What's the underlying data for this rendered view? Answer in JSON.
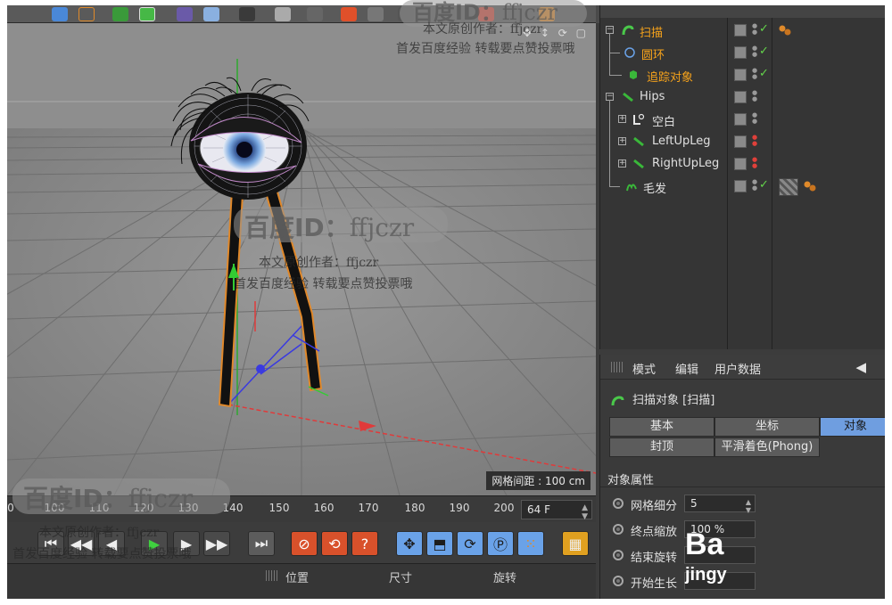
{
  "viewport": {
    "grid_spacing": "网格间距 : 100 cm",
    "nav_icons": [
      "move-view-icon",
      "zoom-view-icon",
      "rotate-view-icon",
      "maximize-view-icon"
    ]
  },
  "timeline": {
    "ticks": [
      "0",
      "100",
      "110",
      "120",
      "130",
      "140",
      "150",
      "160",
      "170",
      "180",
      "190",
      "200"
    ],
    "end_frame": "64 F"
  },
  "transport": {
    "buttons": [
      "go-to-start",
      "previous-key",
      "previous-frame",
      "play",
      "next-frame",
      "go-to-end",
      "record-active",
      "autokey",
      "keyframe-help",
      "key-position",
      "key-scale",
      "key-rotation",
      "key-param",
      "key-pla",
      "timeline-window"
    ]
  },
  "coordinates": {
    "position": "位置",
    "size": "尺寸",
    "rotation": "旋转"
  },
  "object_manager": {
    "objects": [
      {
        "label": "扫描",
        "color": "orange",
        "icon": "sweep-icon",
        "check": true,
        "tag": "tag-balls"
      },
      {
        "label": "圆环",
        "color": "orange",
        "icon": "circle-spline-icon",
        "check": true
      },
      {
        "label": "追踪对象",
        "color": "orange",
        "icon": "tracer-icon",
        "check": true
      },
      {
        "label": "Hips",
        "color": "white",
        "icon": "joint-icon",
        "check": false
      },
      {
        "label": "空白",
        "color": "white",
        "icon": "null-icon",
        "check": false
      },
      {
        "label": "LeftUpLeg",
        "color": "white",
        "icon": "joint-icon",
        "check": false
      },
      {
        "label": "RightUpLeg",
        "color": "white",
        "icon": "joint-icon",
        "check": false
      },
      {
        "label": "毛发",
        "color": "white",
        "icon": "hair-icon",
        "check": true,
        "tag": "hair-material-tag"
      }
    ]
  },
  "attribute_manager": {
    "menu": [
      "模式",
      "编辑",
      "用户数据"
    ],
    "title": "扫描对象 [扫描]",
    "tabs": [
      "基本",
      "坐标",
      "对象",
      "封顶",
      "平滑着色(Phong)"
    ],
    "active_tab": "对象",
    "section": "对象属性",
    "properties": [
      {
        "label": "网格细分",
        "value": "5"
      },
      {
        "label": "终点缩放",
        "value": "100 %"
      },
      {
        "label": "结束旋转",
        "value": ""
      },
      {
        "label": "开始生长",
        "value": ""
      }
    ]
  },
  "watermarks": {
    "badge_title_cn": "百度",
    "badge_title_id": "ID：",
    "badge_handle": "ffjczr",
    "line1": "本文原创作者：ffjczr",
    "line2": "首发百度经验  转载要点赞投票哦",
    "logo_text": "Ba",
    "logo_sub": "jingy"
  }
}
